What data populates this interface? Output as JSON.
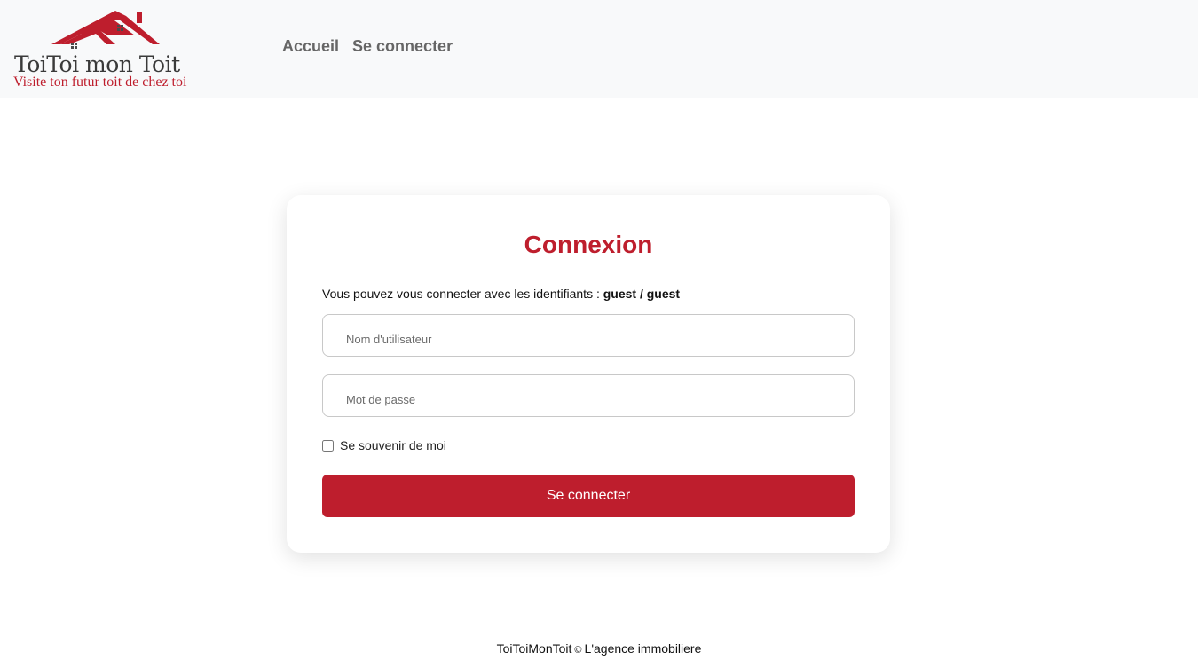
{
  "brand": {
    "name": "ToiToi mon Toit",
    "tagline": "Visite ton futur toit de chez toi",
    "roof_color": "#be1e2d",
    "window_color": "#4a4a4a"
  },
  "nav": {
    "home_label": "Accueil",
    "login_label": "Se connecter"
  },
  "login": {
    "title": "Connexion",
    "hint_prefix": "Vous pouvez vous connecter avec les identifiants :",
    "hint_credentials": "guest / guest",
    "username_placeholder": "Nom d'utilisateur",
    "password_placeholder": "Mot de passe",
    "remember_label": "Se souvenir de moi",
    "submit_label": "Se connecter"
  },
  "footer": {
    "company": "ToiToiMonToit",
    "copyright_symbol": "©",
    "tagline": "L'agence immobiliere"
  },
  "colors": {
    "accent": "#be1e2d",
    "header_bg": "#f8f9fa"
  }
}
